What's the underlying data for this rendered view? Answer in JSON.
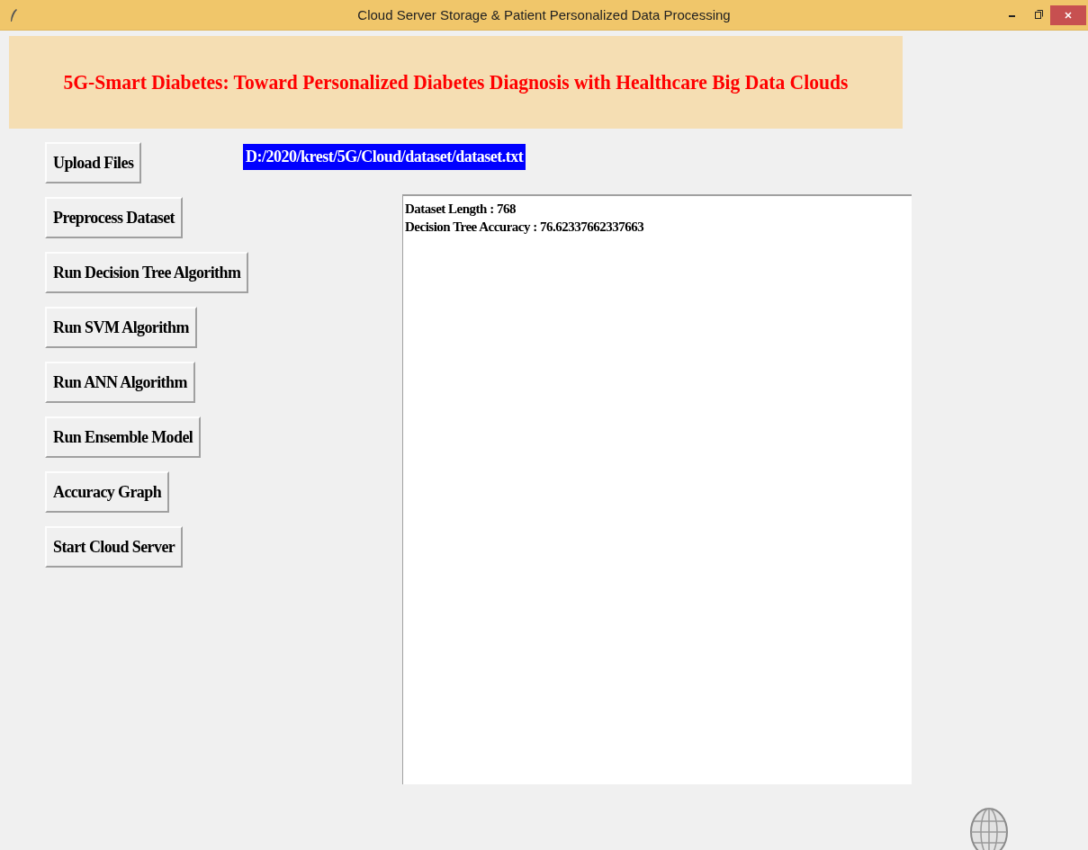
{
  "window": {
    "title": "Cloud Server Storage & Patient Personalized Data Processing"
  },
  "header": {
    "title": "5G-Smart Diabetes: Toward Personalized Diabetes Diagnosis with Healthcare Big Data Clouds"
  },
  "buttons": [
    {
      "label": "Upload Files"
    },
    {
      "label": "Preprocess Dataset"
    },
    {
      "label": "Run Decision Tree Algorithm"
    },
    {
      "label": "Run SVM Algorithm"
    },
    {
      "label": "Run ANN Algorithm"
    },
    {
      "label": "Run Ensemble Model"
    },
    {
      "label": "Accuracy Graph"
    },
    {
      "label": "Start Cloud Server"
    }
  ],
  "file_path": "D:/2020/krest/5G/Cloud/dataset/dataset.txt",
  "output": {
    "lines": [
      "Dataset Length : 768",
      "Decision Tree Accuracy : 76.62337662337663"
    ]
  }
}
